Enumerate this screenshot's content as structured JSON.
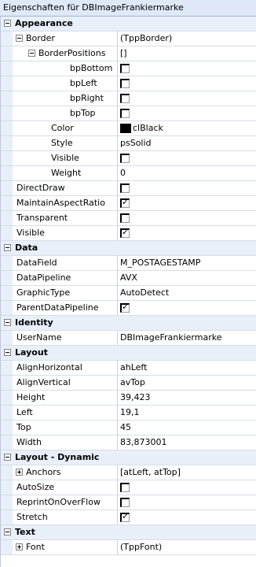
{
  "title": "Eigenschaften für DBImageFrankiermarke",
  "categories": {
    "appearance": "Appearance",
    "data": "Data",
    "identity": "Identity",
    "layout": "Layout",
    "layout_dynamic": "Layout - Dynamic",
    "text": "Text"
  },
  "props": {
    "border": {
      "name": "Border",
      "value": "(TppBorder)"
    },
    "border_positions": {
      "name": "BorderPositions",
      "value": "[]"
    },
    "bp_bottom": {
      "name": "bpBottom",
      "checked": false
    },
    "bp_left": {
      "name": "bpLeft",
      "checked": false
    },
    "bp_right": {
      "name": "bpRight",
      "checked": false
    },
    "bp_top": {
      "name": "bpTop",
      "checked": false
    },
    "color": {
      "name": "Color",
      "value": "clBlack",
      "swatch": "#000000"
    },
    "style": {
      "name": "Style",
      "value": "psSolid"
    },
    "border_visible": {
      "name": "Visible",
      "checked": false
    },
    "weight": {
      "name": "Weight",
      "value": "0"
    },
    "direct_draw": {
      "name": "DirectDraw",
      "checked": false
    },
    "maintain_aspect": {
      "name": "MaintainAspectRatio",
      "checked": true
    },
    "transparent": {
      "name": "Transparent",
      "checked": false
    },
    "visible": {
      "name": "Visible",
      "checked": true
    },
    "data_field": {
      "name": "DataField",
      "value": "M_POSTAGESTAMP"
    },
    "data_pipeline": {
      "name": "DataPipeline",
      "value": "AVX"
    },
    "graphic_type": {
      "name": "GraphicType",
      "value": "AutoDetect"
    },
    "parent_data_pipeline": {
      "name": "ParentDataPipeline",
      "checked": true
    },
    "user_name": {
      "name": "UserName",
      "value": "DBImageFrankiermarke"
    },
    "align_horizontal": {
      "name": "AlignHorizontal",
      "value": "ahLeft"
    },
    "align_vertical": {
      "name": "AlignVertical",
      "value": "avTop"
    },
    "height": {
      "name": "Height",
      "value": "39,423"
    },
    "left": {
      "name": "Left",
      "value": "19,1"
    },
    "top": {
      "name": "Top",
      "value": "45"
    },
    "width": {
      "name": "Width",
      "value": "83,873001"
    },
    "anchors": {
      "name": "Anchors",
      "value": "[atLeft, atTop]"
    },
    "auto_size": {
      "name": "AutoSize",
      "checked": false
    },
    "reprint_on_overflow": {
      "name": "ReprintOnOverFlow",
      "checked": false
    },
    "stretch": {
      "name": "Stretch",
      "checked": true
    },
    "font": {
      "name": "Font",
      "value": "(TppFont)"
    }
  }
}
